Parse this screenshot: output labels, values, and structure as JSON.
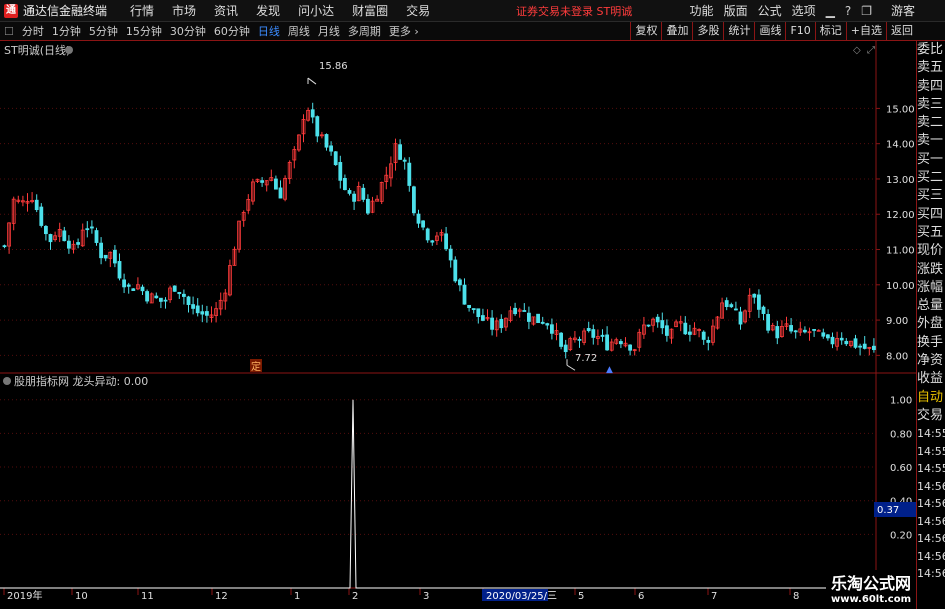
{
  "menubar": {
    "app_title": "通达信金融终端",
    "items": [
      "行情",
      "市场",
      "资讯",
      "发现",
      "问小达",
      "财富圈",
      "交易"
    ],
    "warning": "证券交易未登录 ST明诚",
    "right_items": [
      "功能",
      "版面",
      "公式",
      "选项"
    ],
    "guest_label": "游客"
  },
  "periodbar": {
    "periods": [
      "分时",
      "1分钟",
      "5分钟",
      "15分钟",
      "30分钟",
      "60分钟",
      "日线",
      "周线",
      "月线",
      "多周期",
      "更多"
    ],
    "active": "日线",
    "tools": [
      "复权",
      "叠加",
      "多股",
      "统计",
      "画线",
      "F10",
      "标记",
      "+自选",
      "返回"
    ]
  },
  "main_chart": {
    "title": "ST明诚(日线)",
    "high_label": "15.86",
    "low_label": "7.72",
    "marker_label": "定",
    "colors": {
      "up": "#ff3b3b",
      "down": "#4de0ea",
      "grid": "#8b1515",
      "axis_text": "#e0e0e0"
    }
  },
  "chart_data": [
    {
      "type": "candlestick",
      "title": "ST明诚(日线)",
      "y_ticks": [
        "15.00",
        "14.00",
        "13.00",
        "12.00",
        "11.00",
        "10.00",
        "9.00",
        "8.00"
      ],
      "ylim": [
        7.5,
        16.4
      ],
      "x_ticks": [
        "2019年",
        "10",
        "11",
        "12",
        "1",
        "2",
        "3",
        "2020/03/25/三",
        "5",
        "6",
        "7",
        "8"
      ],
      "highest": 15.86,
      "lowest": 7.72,
      "close_path": [
        11.1,
        12.4,
        12.3,
        12.6,
        11.9,
        11.2,
        11.6,
        11.3,
        10.9,
        11.8,
        11.4,
        10.8,
        10.9,
        10.3,
        9.9,
        10.0,
        9.7,
        9.6,
        9.5,
        10.0,
        9.8,
        9.3,
        9.2,
        9.1,
        9.3,
        10.0,
        11.2,
        12.2,
        12.8,
        12.9,
        13.1,
        12.5,
        13.3,
        13.9,
        15.2,
        14.4,
        14.0,
        13.6,
        12.9,
        12.4,
        12.7,
        12.1,
        12.6,
        13.1,
        13.9,
        13.6,
        12.3,
        11.7,
        11.3,
        11.5,
        10.9,
        10.1,
        9.5,
        9.2,
        9.0,
        8.8,
        8.9,
        9.3,
        9.4,
        9.1,
        9.0,
        9.0,
        8.7,
        8.0,
        8.4,
        8.5,
        8.6,
        8.5,
        8.3,
        8.5,
        8.4,
        8.2,
        8.8,
        9.0,
        8.8,
        8.5,
        8.9,
        8.7,
        8.8,
        8.3,
        8.9,
        9.6,
        9.3,
        8.9,
        9.7,
        9.4,
        8.9,
        8.6,
        8.8,
        8.6,
        8.6,
        8.7,
        8.5,
        8.3,
        8.6,
        8.4,
        8.3,
        8.2,
        8.1
      ]
    },
    {
      "type": "line",
      "title": "股朋指标网 龙头异动: 0.00",
      "y_ticks": [
        "1.00",
        "0.80",
        "0.60",
        "0.40",
        "0.20"
      ],
      "ylim": [
        0,
        1.04
      ],
      "spike_index": 0.41,
      "cursor_value": "0.37"
    }
  ],
  "sub_chart": {
    "title": "股朋指标网 龙头异动: 0.00",
    "cursor_value": "0.37"
  },
  "side_panel": {
    "labels": [
      "委比",
      "卖五",
      "卖四",
      "卖三",
      "卖二",
      "卖一",
      "买一",
      "买二",
      "买三",
      "买四",
      "买五",
      "现价",
      "涨跌",
      "涨幅",
      "总量",
      "外盘",
      "换手",
      "净资",
      "收益"
    ],
    "auto_trade": [
      "自动",
      "交易"
    ],
    "times": [
      "14:55",
      "14:55",
      "14:55",
      "14:56",
      "14:56",
      "14:56",
      "14:56",
      "14:56",
      "14:56"
    ]
  },
  "watermark": {
    "title": "乐淘公式网",
    "url": "www.60lt.com"
  }
}
